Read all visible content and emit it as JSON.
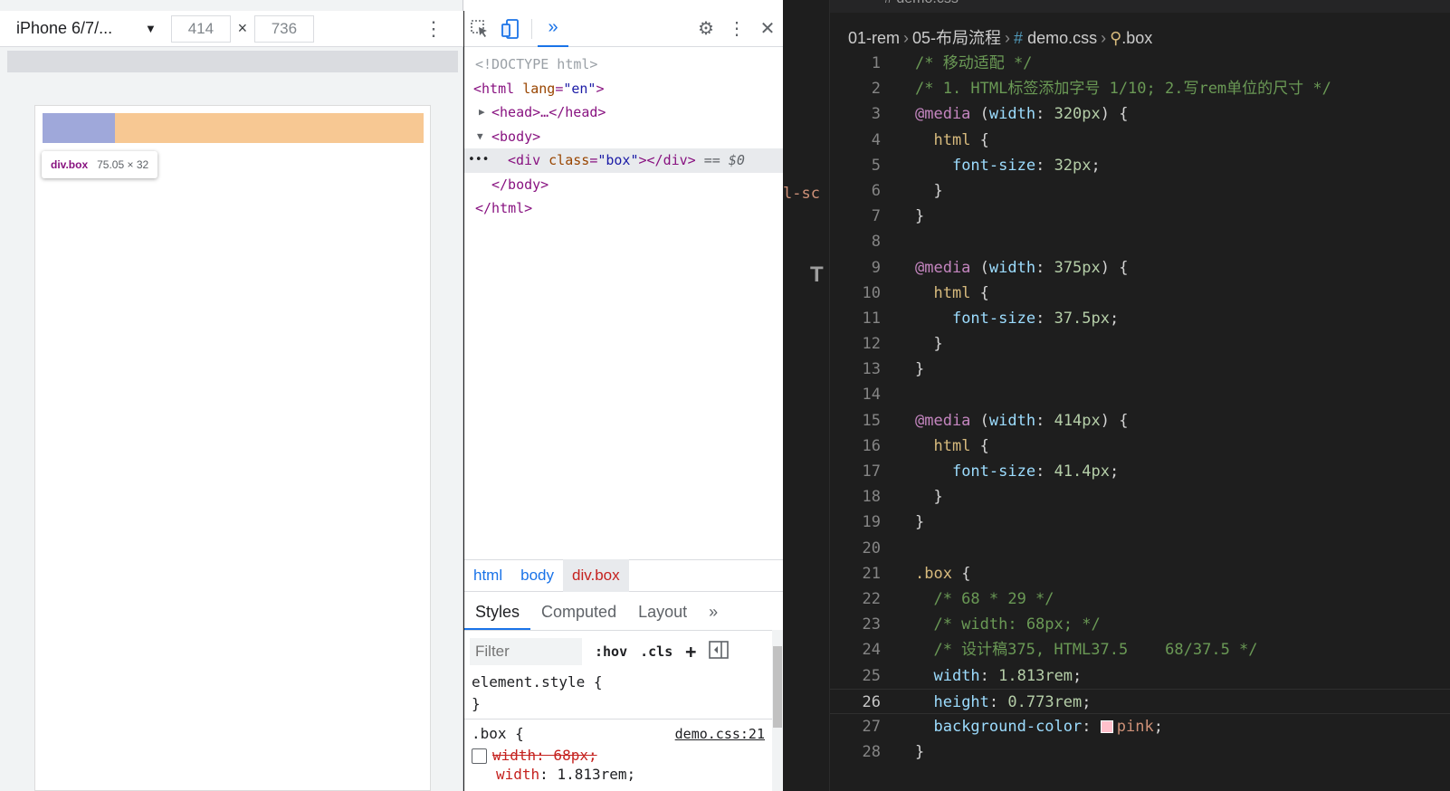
{
  "device_toolbar": {
    "device_name": "iPhone 6/7/...",
    "width_value": "414",
    "height_value": "736",
    "times": "×"
  },
  "viewport": {
    "tooltip_name": "div.box",
    "tooltip_size": "75.05 × 32",
    "highlight_color": "#9fa8da",
    "box_color": "#f7c893"
  },
  "devtools": {
    "more_panels": "»",
    "dom": {
      "doctype": "<!DOCTYPE html>",
      "html_open_tag": "<html",
      "html_attr": "lang",
      "html_attr_value": "\"en\"",
      "head": "<head>…</head>",
      "body_open": "<body>",
      "div_tag": "<div",
      "div_attr": "class",
      "div_attr_value": "\"box\"",
      "div_close": "></div>",
      "dollar": "== $0",
      "body_close": "</body>",
      "html_close": "</html>",
      "ellipsis": "•••"
    },
    "breadcrumbs": [
      "html",
      "body",
      "div.box"
    ],
    "styles_tabs": [
      "Styles",
      "Computed",
      "Layout",
      "»"
    ],
    "filter_placeholder": "Filter",
    "filter_buttons": [
      ":hov",
      ".cls",
      "+"
    ],
    "element_style": "element.style {",
    "close_brace": "}",
    "rule_selector": ".box {",
    "rule_source": "demo.css:21",
    "struck_prop": "width: 68px;",
    "active_prop_name": "width",
    "active_prop_value": ": 1.813rem;"
  },
  "vscode": {
    "tab_label": "# demo.css",
    "left_fragment": "l-sc",
    "breadcrumb": [
      "01-rem",
      "05-布局流程",
      "demo.css",
      ".box"
    ],
    "lines": [
      {
        "n": "1",
        "text": "/* 移动适配 */"
      },
      {
        "n": "2",
        "text": "/* 1. HTML标签添加字号 1/10; 2.写rem单位的尺寸 */"
      },
      {
        "n": "3",
        "text": "@media (width: 320px) {"
      },
      {
        "n": "4",
        "text": "  html {"
      },
      {
        "n": "5",
        "text": "    font-size: 32px;"
      },
      {
        "n": "6",
        "text": "  }"
      },
      {
        "n": "7",
        "text": "}"
      },
      {
        "n": "8",
        "text": ""
      },
      {
        "n": "9",
        "text": "@media (width: 375px) {"
      },
      {
        "n": "10",
        "text": "  html {"
      },
      {
        "n": "11",
        "text": "    font-size: 37.5px;"
      },
      {
        "n": "12",
        "text": "  }"
      },
      {
        "n": "13",
        "text": "}"
      },
      {
        "n": "14",
        "text": ""
      },
      {
        "n": "15",
        "text": "@media (width: 414px) {"
      },
      {
        "n": "16",
        "text": "  html {"
      },
      {
        "n": "17",
        "text": "    font-size: 41.4px;"
      },
      {
        "n": "18",
        "text": "  }"
      },
      {
        "n": "19",
        "text": "}"
      },
      {
        "n": "20",
        "text": ""
      },
      {
        "n": "21",
        "text": ".box {"
      },
      {
        "n": "22",
        "text": "  /* 68 * 29 */"
      },
      {
        "n": "23",
        "text": "  /* width: 68px; */"
      },
      {
        "n": "24",
        "text": "  /* 设计稿375, HTML37.5    68/37.5 */"
      },
      {
        "n": "25",
        "text": "  width: 1.813rem;"
      },
      {
        "n": "26",
        "text": "  height: 0.773rem;"
      },
      {
        "n": "27",
        "text": "  background-color: pink;"
      },
      {
        "n": "28",
        "text": "}"
      }
    ],
    "active_line": "26"
  }
}
